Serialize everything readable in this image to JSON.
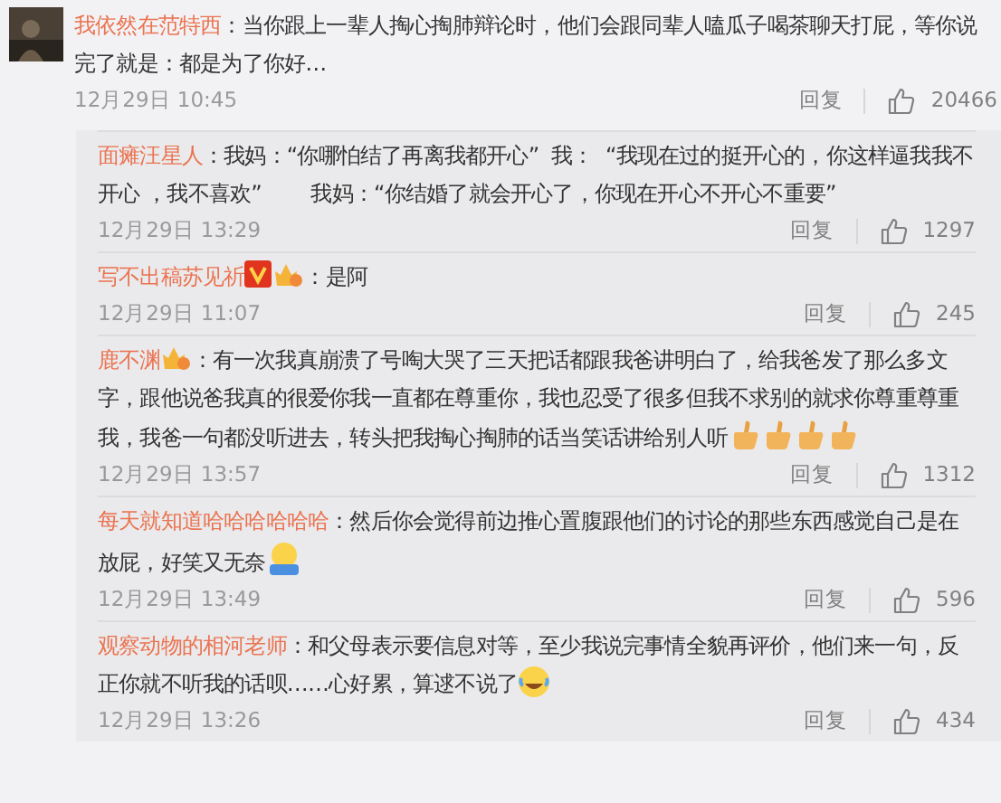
{
  "comment": {
    "user": "我依然在范特西",
    "text": "：当你跟上一辈人掏心掏肺辩论时，他们会跟同辈人嗑瓜子喝茶聊天打屁，等你说完了就是：都是为了你好…",
    "time": "12月29日 10:45",
    "reply": "回复",
    "likes": "20466"
  },
  "replies": [
    {
      "user": "面瘫汪星人",
      "text": "：我妈：“你哪怕结了再离我都开心”  我：  “我现在过的挺开心的，你这样逼我我不开心 ，我不喜欢”        我妈：“你结婚了就会开心了，你现在开心不开心不重要”",
      "time": "12月29日 13:29",
      "reply": "回复",
      "likes": "1297"
    },
    {
      "user": "写不出稿苏见祈",
      "badges": [
        {
          "kind": "verified"
        },
        {
          "kind": "crown"
        }
      ],
      "text": "：是阿",
      "time": "12月29日 11:07",
      "reply": "回复",
      "likes": "245"
    },
    {
      "user": "鹿不渊",
      "badges": [
        {
          "kind": "crown"
        }
      ],
      "text": "：有一次我真崩溃了号啕大哭了三天把话都跟我爸讲明白了，给我爸发了那么多文字，跟他说爸我真的很爱你我一直都在尊重你，我也忍受了很多但我不求别的就求你尊重尊重我，我爸一句都没听进去，转头把我掏心掏肺的话当笑话讲给别人听",
      "emojis": [
        {
          "kind": "thumbs-up"
        },
        {
          "kind": "thumbs-up"
        },
        {
          "kind": "thumbs-up"
        },
        {
          "kind": "thumbs-up"
        }
      ],
      "time": "12月29日 13:57",
      "reply": "回复",
      "likes": "1312"
    },
    {
      "user": "每天就知道哈哈哈哈哈哈",
      "text": "：然后你会觉得前边推心置腹跟他们的讨论的那些东西感觉自己是在放屁，好笑又无奈",
      "emojis": [
        {
          "kind": "shrug"
        }
      ],
      "time": "12月29日 13:49",
      "reply": "回复",
      "likes": "596"
    },
    {
      "user": "观察动物的相河老师",
      "text": "：和父母表示要信息对等，至少我说完事情全貌再评价，他们来一句，反正你就不听我的话呗……心好累，算逑不说了",
      "emojis": [
        {
          "kind": "laugh-cry"
        }
      ],
      "time": "12月29日 13:26",
      "reply": "回复",
      "likes": "434"
    }
  ]
}
